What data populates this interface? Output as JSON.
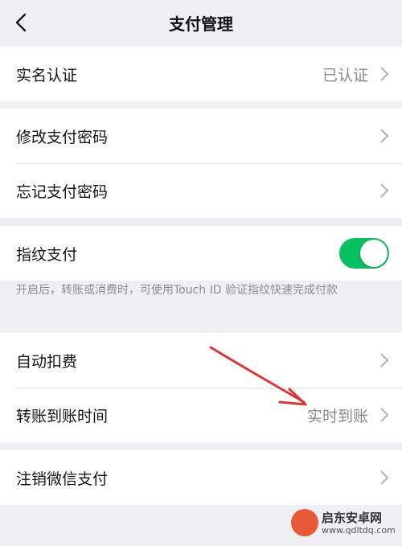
{
  "header": {
    "title": "支付管理",
    "back_icon": "chevron-left-icon"
  },
  "sections": {
    "realname": {
      "label": "实名认证",
      "value": "已认证"
    },
    "modify_password": {
      "label": "修改支付密码"
    },
    "forgot_password": {
      "label": "忘记支付密码"
    },
    "fingerprint": {
      "label": "指纹支付",
      "enabled": true,
      "note": "开启后，转账或消费时，可使用Touch ID 验证指纹快速完成付款"
    },
    "auto_deduct": {
      "label": "自动扣费"
    },
    "transfer_time": {
      "label": "转账到账时间",
      "value": "实时到账"
    },
    "cancel_wechat_pay": {
      "label": "注销微信支付"
    }
  },
  "colors": {
    "background": "#efeff4",
    "toggle_on": "#07c160",
    "annotation": "#d9383a"
  },
  "watermark": {
    "name": "启东安卓网",
    "url": "www.qdltdq.com"
  }
}
